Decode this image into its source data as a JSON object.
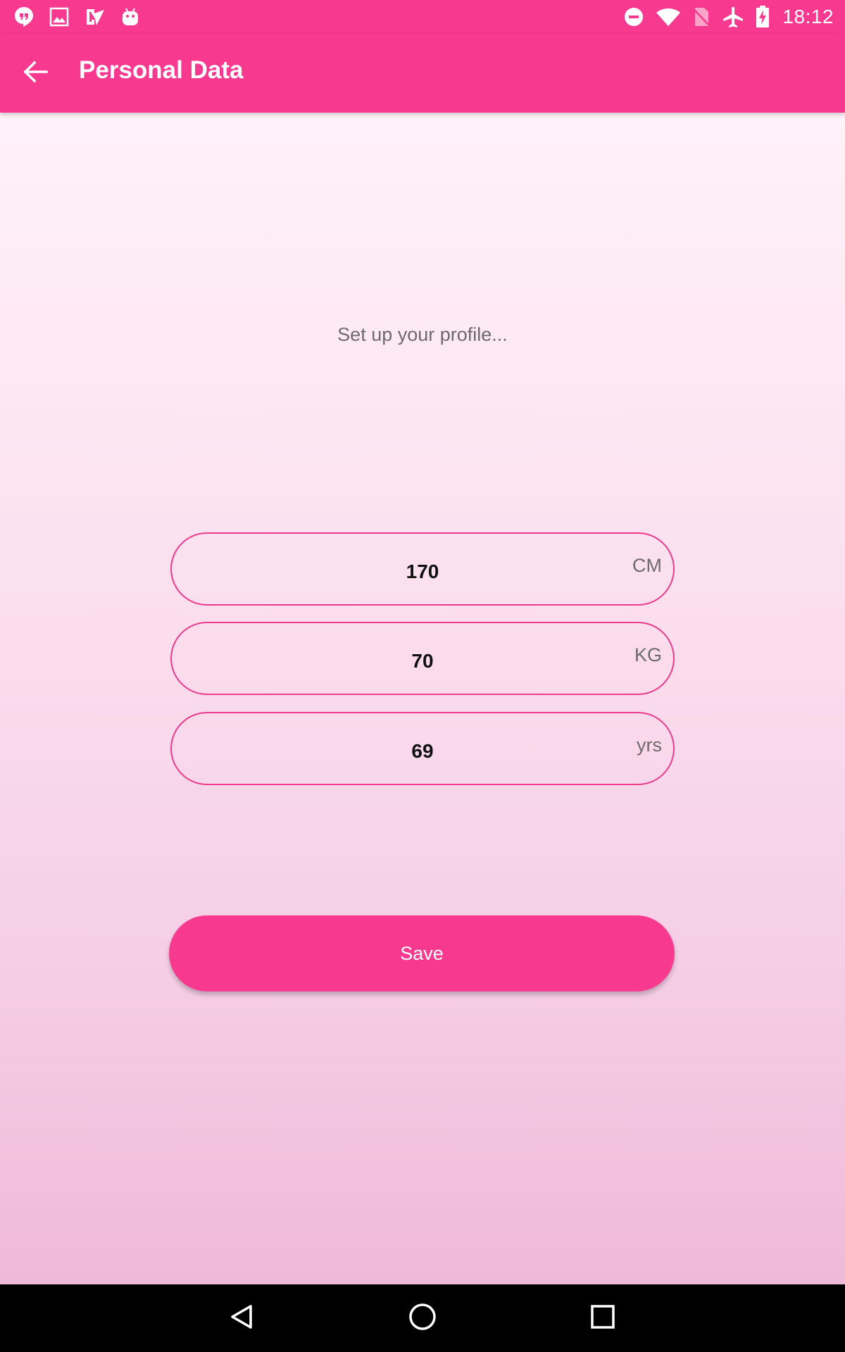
{
  "status_bar": {
    "time": "18:12",
    "left_icons": [
      "hangouts-icon",
      "image-icon",
      "play-store-icon",
      "android-icon"
    ],
    "right_icons": [
      "do-not-disturb-icon",
      "wifi-icon",
      "no-sim-icon",
      "airplane-mode-icon",
      "battery-charging-icon"
    ]
  },
  "app_bar": {
    "title": "Personal Data",
    "back_icon": "arrow-back-icon"
  },
  "main": {
    "subtitle": "Set up your profile...",
    "fields": [
      {
        "value": "170",
        "unit": "CM"
      },
      {
        "value": "70",
        "unit": "KG"
      },
      {
        "value": "69",
        "unit": "yrs"
      }
    ],
    "save_label": "Save"
  },
  "nav_bar": {
    "icons": [
      "back-triangle-icon",
      "home-circle-icon",
      "recents-square-icon"
    ]
  },
  "colors": {
    "accent": "#f7398f",
    "field_border": "#ec3a8c",
    "muted_text": "#6e6a6c"
  }
}
